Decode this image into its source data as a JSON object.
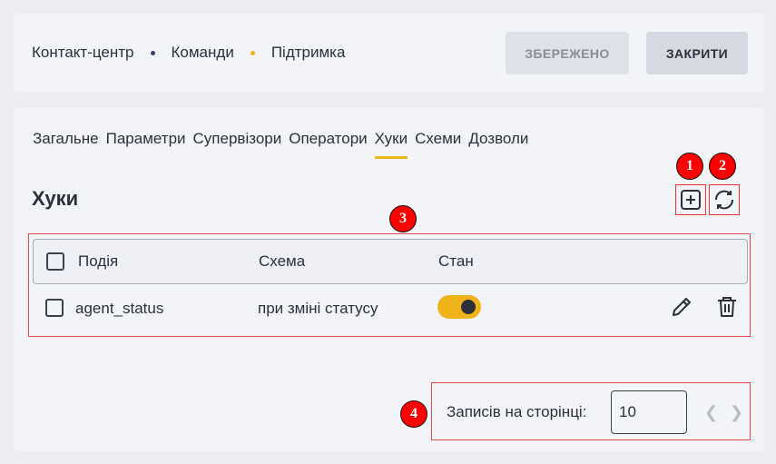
{
  "header": {
    "breadcrumb": [
      {
        "label": "Контакт-центр",
        "dot_color": "#3a3f6b"
      },
      {
        "label": "Команди",
        "dot_color": "#f0b31a"
      },
      {
        "label": "Підтримка"
      }
    ],
    "saved_label": "ЗБЕРЕЖЕНО",
    "close_label": "ЗАКРИТИ"
  },
  "tabs": [
    {
      "label": "Загальне"
    },
    {
      "label": "Параметри"
    },
    {
      "label": "Супервізори"
    },
    {
      "label": "Оператори"
    },
    {
      "label": "Хуки",
      "active": true
    },
    {
      "label": "Схеми"
    },
    {
      "label": "Дозволи"
    }
  ],
  "section": {
    "title": "Хуки",
    "add_icon": "plus-square-icon",
    "refresh_icon": "refresh-icon"
  },
  "table": {
    "columns": [
      "Подія",
      "Схема",
      "Стан"
    ],
    "rows": [
      {
        "event": "agent_status",
        "schema": "при зміні статусу",
        "state": true
      }
    ]
  },
  "pagination": {
    "label": "Записів на сторінці:",
    "value": "10"
  },
  "annotations": [
    "1",
    "2",
    "3",
    "4"
  ],
  "colors": {
    "accent": "#f0b31a",
    "annotation_red": "#ff0000"
  }
}
